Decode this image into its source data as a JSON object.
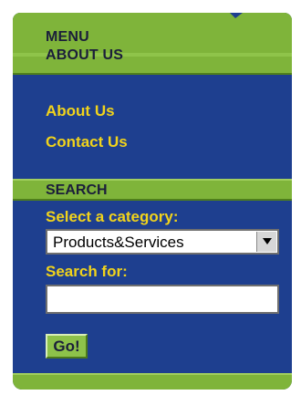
{
  "menu": {
    "title": "MENU",
    "section": "ABOUT US",
    "links": [
      {
        "label": "About Us"
      },
      {
        "label": "Contact Us"
      }
    ]
  },
  "search": {
    "title": "SEARCH",
    "category_label": "Select a category:",
    "category_value": "Products&Services",
    "search_label": "Search for:",
    "search_value": "",
    "go_label": "Go!"
  },
  "colors": {
    "panel": "#1e3f8f",
    "band": "#7fb43a",
    "link": "#f1d31b",
    "header_text": "#1b1e3a"
  },
  "icons": {
    "dropdown": "chevron-down-icon"
  }
}
